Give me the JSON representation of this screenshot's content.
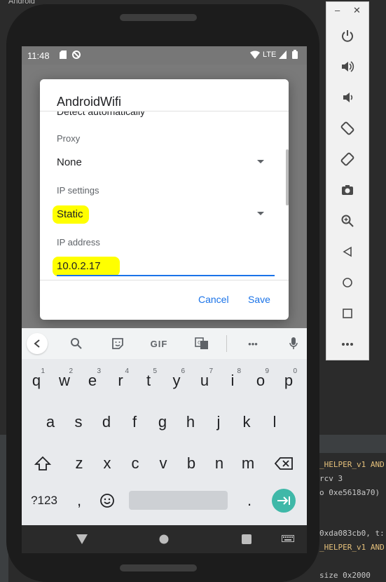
{
  "ide": {
    "project_label": "Android",
    "terminal_lines": [
      "_HELPER_v1 AND",
      " rcv 3",
      "o 0xe5618a70)",
      "0xda083cb0, t:",
      "_HELPER_v1 AND",
      " size 0x2000"
    ]
  },
  "emulator": {
    "minimize": "–",
    "close": "✕"
  },
  "status_bar": {
    "time": "11:48",
    "network": "LTE"
  },
  "dialog": {
    "title": "AndroidWifi",
    "clipped_text": "Detect automatically",
    "proxy_label": "Proxy",
    "proxy_value": "None",
    "ip_settings_label": "IP settings",
    "ip_settings_value": "Static",
    "ip_address_label": "IP address",
    "ip_address_value": "10.0.2.17",
    "cancel": "Cancel",
    "save": "Save"
  },
  "keyboard": {
    "toolbar_gif": "GIF",
    "toolbar_more": "•••",
    "row1": [
      {
        "k": "q",
        "h": "1"
      },
      {
        "k": "w",
        "h": "2"
      },
      {
        "k": "e",
        "h": "3"
      },
      {
        "k": "r",
        "h": "4"
      },
      {
        "k": "t",
        "h": "5"
      },
      {
        "k": "y",
        "h": "6"
      },
      {
        "k": "u",
        "h": "7"
      },
      {
        "k": "i",
        "h": "8"
      },
      {
        "k": "o",
        "h": "9"
      },
      {
        "k": "p",
        "h": "0"
      }
    ],
    "row2": [
      "a",
      "s",
      "d",
      "f",
      "g",
      "h",
      "j",
      "k",
      "l"
    ],
    "row3": [
      "z",
      "x",
      "c",
      "v",
      "b",
      "n",
      "m"
    ],
    "symbols": "?123",
    "comma": ",",
    "period": "."
  },
  "colors": {
    "highlight": "#ffff00",
    "accent": "#1a73e8",
    "enter_key": "#3fb8a8"
  }
}
